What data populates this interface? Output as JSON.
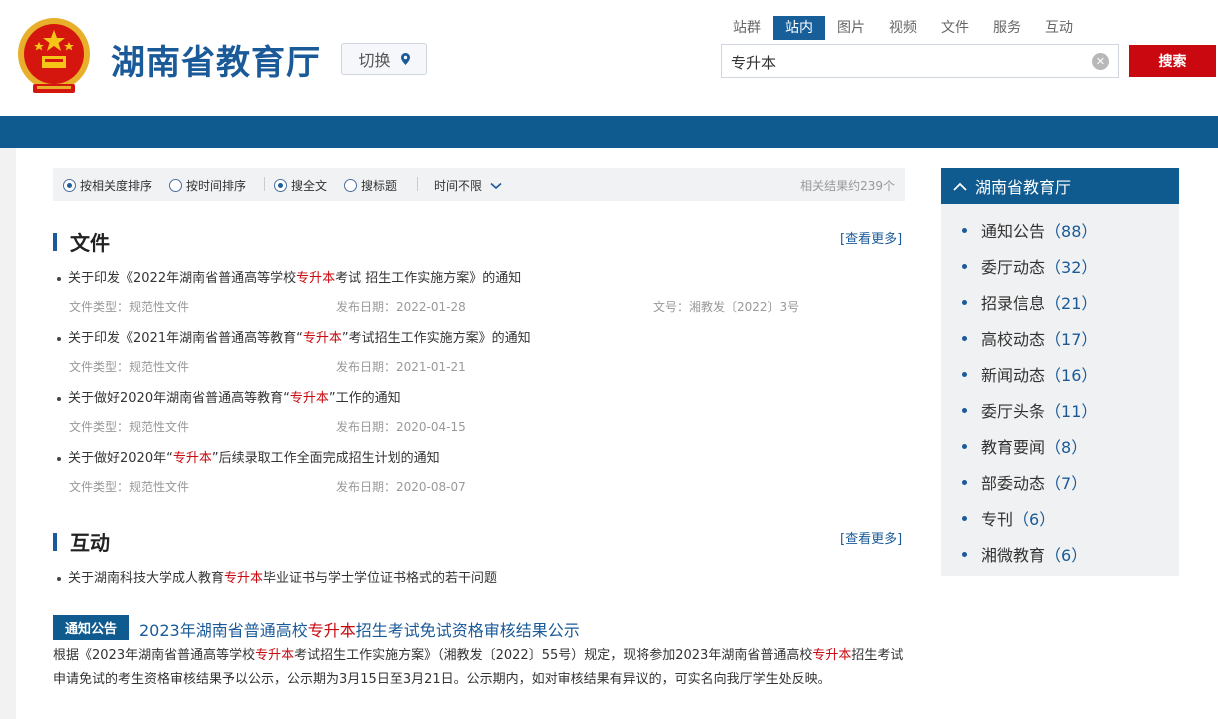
{
  "header": {
    "site_title": "湖南省教育厅",
    "switch_label": "切换",
    "tabs": [
      "站群",
      "站内",
      "图片",
      "视频",
      "文件",
      "服务",
      "互动"
    ],
    "active_tab": "站内",
    "search_value": "专升本",
    "search_button": "搜索"
  },
  "filters": {
    "sort_relevance": "按相关度排序",
    "sort_time": "按时间排序",
    "search_full": "搜全文",
    "search_title": "搜标题",
    "time_limit": "时间不限",
    "result_count": "相关结果约239个"
  },
  "files_section": {
    "title": "文件",
    "more": "[查看更多]",
    "items": [
      {
        "pre": "关于印发《2022年湖南省普通高等学校",
        "hl": "专升本",
        "post": "考试 招生工作实施方案》的通知",
        "type": "文件类型：规范性文件",
        "date": "发布日期：2022-01-28",
        "doc_no": "文号：湘教发〔2022〕3号"
      },
      {
        "pre": "关于印发《2021年湖南省普通高等教育“",
        "hl": "专升本",
        "post": "”考试招生工作实施方案》的通知",
        "type": "文件类型：规范性文件",
        "date": "发布日期：2021-01-21"
      },
      {
        "pre": "关于做好2020年湖南省普通高等教育“",
        "hl": "专升本",
        "post": "”工作的通知",
        "type": "文件类型：规范性文件",
        "date": "发布日期：2020-04-15"
      },
      {
        "pre": "关于做好2020年“",
        "hl": "专升本",
        "post": "”后续录取工作全面完成招生计划的通知",
        "type": "文件类型：规范性文件",
        "date": "发布日期：2020-08-07"
      }
    ]
  },
  "interaction_section": {
    "title": "互动",
    "more": "[查看更多]",
    "items": [
      {
        "pre": "关于湖南科技大学成人教育",
        "hl": "专升本",
        "post": "毕业证书与学士学位证书格式的若干问题"
      }
    ]
  },
  "notice": {
    "badge": "通知公告",
    "title_pre": "2023年湖南省普通高校",
    "title_hl": "专升本",
    "title_post": "招生考试免试资格审核结果公示",
    "body_1": "根据《2023年湖南省普通高等学校",
    "body_hl_1": "专升本",
    "body_2": "考试招生工作实施方案》（湘教发〔2022〕55号）规定，现将参加2023年湖南省普通高校",
    "body_hl_2": "专升本",
    "body_3": "招生考试申请免试的考生资格审核结果予以公示，公示期为3月15日至3月21日。公示期内，如对审核结果有异议的，可实名向我厅学生处反映。"
  },
  "sidebar": {
    "title": "湖南省教育厅",
    "items": [
      {
        "label": "通知公告",
        "count": "（88）"
      },
      {
        "label": "委厅动态",
        "count": "（32）"
      },
      {
        "label": "招录信息",
        "count": "（21）"
      },
      {
        "label": "高校动态",
        "count": "（17）"
      },
      {
        "label": "新闻动态",
        "count": "（16）"
      },
      {
        "label": "委厅头条",
        "count": "（11）"
      },
      {
        "label": "教育要闻",
        "count": "（8）"
      },
      {
        "label": "部委动态",
        "count": "（7）"
      },
      {
        "label": "专刊",
        "count": "（6）"
      },
      {
        "label": "湘微教育",
        "count": "（6）"
      }
    ]
  },
  "colors": {
    "brand_blue": "#0f5a8e",
    "highlight_red": "#c9080f"
  }
}
